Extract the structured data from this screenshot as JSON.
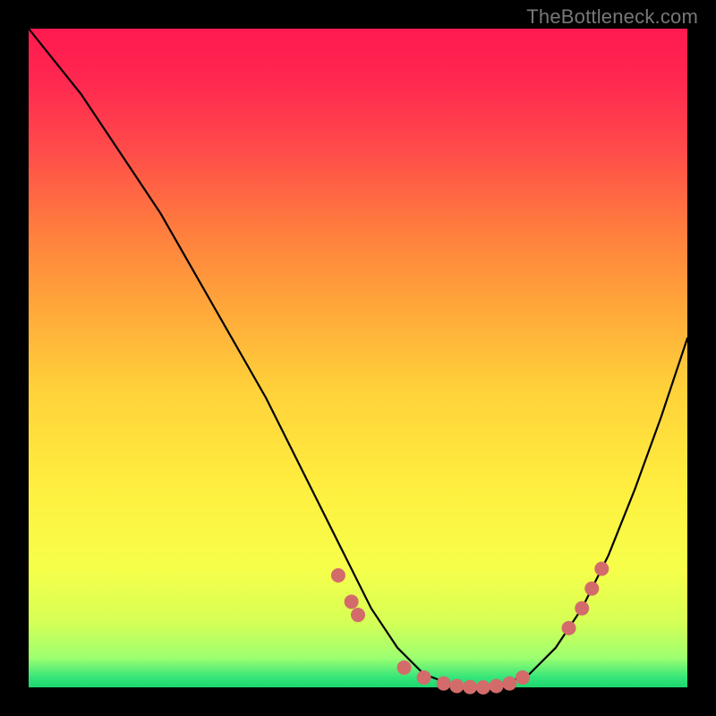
{
  "watermark": {
    "text": "TheBottleneck.com"
  },
  "gradient": {
    "stops": [
      {
        "offset": 0.0,
        "color": "#ff1a4f"
      },
      {
        "offset": 0.08,
        "color": "#ff2850"
      },
      {
        "offset": 0.18,
        "color": "#ff4a4a"
      },
      {
        "offset": 0.3,
        "color": "#ff7b3e"
      },
      {
        "offset": 0.42,
        "color": "#ffa63a"
      },
      {
        "offset": 0.55,
        "color": "#ffd23a"
      },
      {
        "offset": 0.7,
        "color": "#ffef3f"
      },
      {
        "offset": 0.82,
        "color": "#f6ff4a"
      },
      {
        "offset": 0.9,
        "color": "#d6ff55"
      },
      {
        "offset": 0.955,
        "color": "#9dff70"
      },
      {
        "offset": 0.985,
        "color": "#35e57a"
      },
      {
        "offset": 1.0,
        "color": "#1bd66f"
      }
    ]
  },
  "chart_data": {
    "type": "line",
    "title": "",
    "xlabel": "",
    "ylabel": "",
    "xlim": [
      0,
      100
    ],
    "ylim": [
      0,
      100
    ],
    "grid": false,
    "series": [
      {
        "name": "curve",
        "x": [
          0,
          4,
          8,
          12,
          16,
          20,
          24,
          28,
          32,
          36,
          40,
          44,
          48,
          52,
          56,
          60,
          64,
          68,
          72,
          76,
          80,
          84,
          88,
          92,
          96,
          100
        ],
        "y": [
          100,
          95,
          90,
          84,
          78,
          72,
          65,
          58,
          51,
          44,
          36,
          28,
          20,
          12,
          6,
          2,
          0.5,
          0,
          0.5,
          2,
          6,
          12,
          20,
          30,
          41,
          53
        ],
        "stroke": "#000000",
        "stroke_width": 2.2
      }
    ],
    "markers": {
      "color": "#d36b6b",
      "radius": 8,
      "points": [
        {
          "x": 47,
          "y": 17
        },
        {
          "x": 49,
          "y": 13
        },
        {
          "x": 50,
          "y": 11
        },
        {
          "x": 57,
          "y": 3
        },
        {
          "x": 60,
          "y": 1.5
        },
        {
          "x": 63,
          "y": 0.6
        },
        {
          "x": 65,
          "y": 0.2
        },
        {
          "x": 67,
          "y": 0.05
        },
        {
          "x": 69,
          "y": 0.0
        },
        {
          "x": 71,
          "y": 0.2
        },
        {
          "x": 73,
          "y": 0.6
        },
        {
          "x": 75,
          "y": 1.5
        },
        {
          "x": 82,
          "y": 9
        },
        {
          "x": 84,
          "y": 12
        },
        {
          "x": 85.5,
          "y": 15
        },
        {
          "x": 87,
          "y": 18
        }
      ]
    }
  }
}
